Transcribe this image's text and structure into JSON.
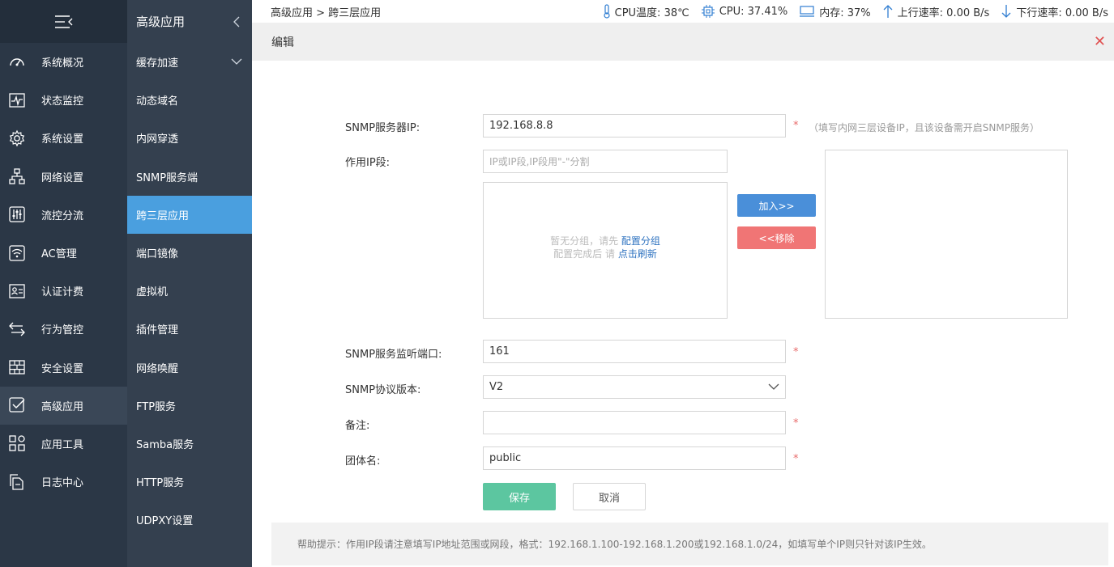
{
  "sidebar": {
    "items": [
      {
        "label": "系统概况",
        "icon": "dashboard-icon"
      },
      {
        "label": "状态监控",
        "icon": "monitor-icon"
      },
      {
        "label": "系统设置",
        "icon": "gear-icon"
      },
      {
        "label": "网络设置",
        "icon": "network-icon"
      },
      {
        "label": "流控分流",
        "icon": "sliders-icon"
      },
      {
        "label": "AC管理",
        "icon": "wifi-icon"
      },
      {
        "label": "认证计费",
        "icon": "id-card-icon"
      },
      {
        "label": "行为管控",
        "icon": "transfer-icon"
      },
      {
        "label": "安全设置",
        "icon": "firewall-icon"
      },
      {
        "label": "高级应用",
        "icon": "checkbox-icon"
      },
      {
        "label": "应用工具",
        "icon": "apps-icon"
      },
      {
        "label": "日志中心",
        "icon": "document-icon"
      }
    ]
  },
  "subnav": {
    "title": "高级应用",
    "items": [
      {
        "label": "缓存加速"
      },
      {
        "label": "动态域名"
      },
      {
        "label": "内网穿透"
      },
      {
        "label": "SNMP服务端"
      },
      {
        "label": "跨三层应用"
      },
      {
        "label": "端口镜像"
      },
      {
        "label": "虚拟机"
      },
      {
        "label": "插件管理"
      },
      {
        "label": "网络唤醒"
      },
      {
        "label": "FTP服务"
      },
      {
        "label": "Samba服务"
      },
      {
        "label": "HTTP服务"
      },
      {
        "label": "UDPXY设置"
      }
    ]
  },
  "topbar": {
    "breadcrumb": "高级应用 > 跨三层应用",
    "cpu_temp": "CPU温度: 38℃",
    "cpu": "CPU: 37.41%",
    "memory": "内存: 37%",
    "upload": "上行速率: 0.00 B/s",
    "download": "下行速率: 0.00 B/s"
  },
  "panel": {
    "title": "编辑",
    "close": "✕"
  },
  "form": {
    "snmp_ip_label": "SNMP服务器IP:",
    "snmp_ip_value": "192.168.8.8",
    "snmp_ip_hint": "（填写内网三层设备IP，且该设备需开启SNMP服务）",
    "ip_range_label": "作用IP段:",
    "ip_range_placeholder": "IP或IP段,IP段用\"-\"分割",
    "empty_line1": "暂无分组，请先 ",
    "empty_link1": "配置分组",
    "empty_line2": "配置完成后 请 ",
    "empty_link2": "点击刷新",
    "add_button": "加入>>",
    "remove_button": "<<移除",
    "port_label": "SNMP服务监听端口:",
    "port_value": "161",
    "version_label": "SNMP协议版本:",
    "version_value": "V2",
    "remark_label": "备注:",
    "remark_value": "",
    "community_label": "团体名:",
    "community_value": "public",
    "required_mark": "*",
    "save_button": "保存",
    "cancel_button": "取消"
  },
  "help": {
    "text": "帮助提示：作用IP段请注意填写IP地址范围或网段，格式：192.168.1.100-192.168.1.200或192.168.1.0/24，如填写单个IP则只针对该IP生效。"
  },
  "colors": {
    "sidebar_bg": "#2b3746",
    "subnav_bg": "#34404f",
    "active_blue": "#4a9fdf",
    "save_green": "#5cc6a0",
    "remove_red": "#f07575",
    "add_blue": "#4a8fd9"
  }
}
